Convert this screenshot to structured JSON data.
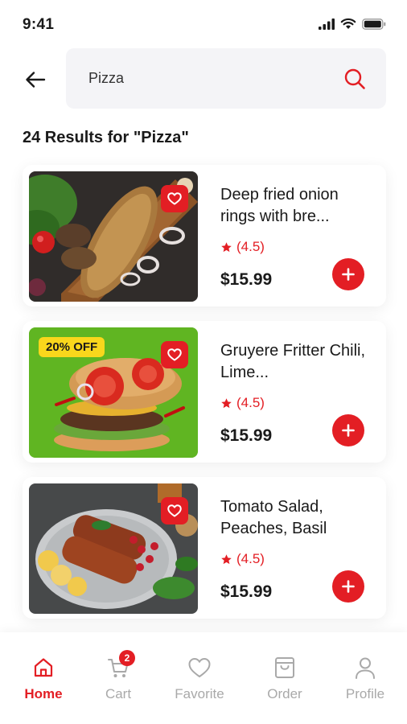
{
  "status_bar": {
    "time": "9:41"
  },
  "search": {
    "value": "Pizza"
  },
  "results_title": "24 Results for \"Pizza\"",
  "colors": {
    "accent": "#e31e24",
    "badge_yellow": "#f9d71c",
    "inactive": "#a9a9a9"
  },
  "products": [
    {
      "title": "Deep fried onion rings with bre...",
      "rating": "(4.5)",
      "price": "$15.99",
      "badge": ""
    },
    {
      "title": "Gruyere Fritter Chili, Lime...",
      "rating": "(4.5)",
      "price": "$15.99",
      "badge": "20% OFF"
    },
    {
      "title": "Tomato Salad, Peaches, Basil",
      "rating": "(4.5)",
      "price": "$15.99",
      "badge": ""
    }
  ],
  "nav": {
    "items": [
      {
        "label": "Home",
        "icon": "home-icon",
        "active": true
      },
      {
        "label": "Cart",
        "icon": "cart-icon",
        "badge": "2"
      },
      {
        "label": "Favorite",
        "icon": "heart-icon"
      },
      {
        "label": "Order",
        "icon": "bag-icon"
      },
      {
        "label": "Profile",
        "icon": "user-icon"
      }
    ]
  }
}
